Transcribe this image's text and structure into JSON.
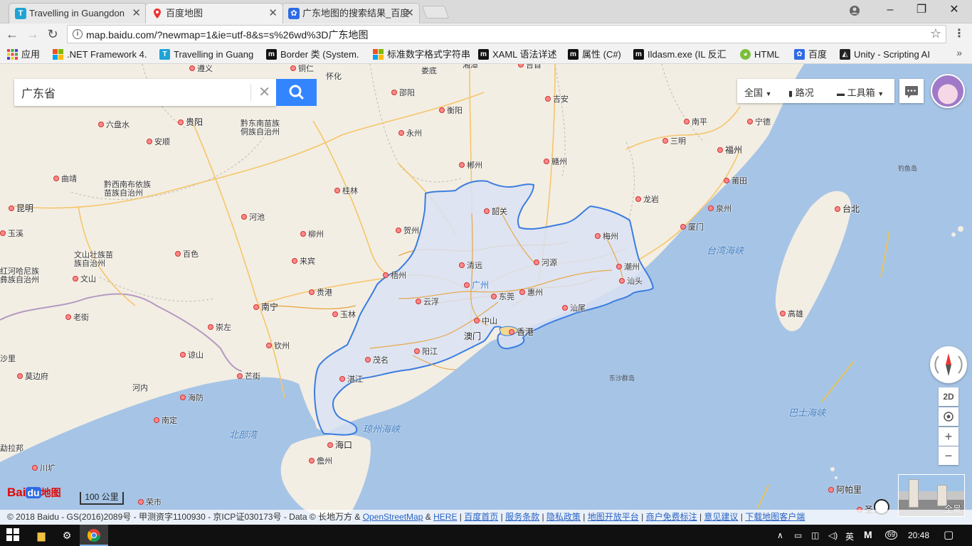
{
  "browser": {
    "tabs": [
      {
        "title": "Travelling in Guangdon",
        "active": false
      },
      {
        "title": "百度地图",
        "active": true
      },
      {
        "title": "广东地图的搜索结果_百度",
        "active": false
      }
    ],
    "close_glyph": "✕",
    "url": "map.baidu.com/?newmap=1&ie=utf-8&s=s%26wd%3D广东地图",
    "bookmarks": [
      {
        "label": "应用",
        "icon": "apps-grid-icon"
      },
      {
        "label": ".NET Framework 4.",
        "icon": "windows-logo-icon"
      },
      {
        "label": "Travelling in Guang",
        "icon": "t-logo-icon"
      },
      {
        "label": "Border 类 (System.",
        "icon": "m-logo-icon"
      },
      {
        "label": "标准数字格式字符串",
        "icon": "windows-logo-icon"
      },
      {
        "label": "XAML 语法详述",
        "icon": "m-logo-icon"
      },
      {
        "label": "属性 (C#)",
        "icon": "m-logo-icon"
      },
      {
        "label": "Ildasm.exe (IL 反汇",
        "icon": "m-logo-icon"
      },
      {
        "label": "HTML",
        "icon": "android-icon"
      },
      {
        "label": "百度",
        "icon": "baidu-paw-icon"
      },
      {
        "label": "Unity - Scripting AI",
        "icon": "unity-icon"
      }
    ]
  },
  "map": {
    "search": {
      "value": "广东省"
    },
    "tools": {
      "region": "全国",
      "traffic": "路况",
      "toolbox": "工具箱"
    },
    "controls": {
      "mode_2d": "2D",
      "zoom_in": "+",
      "zoom_out": "−"
    },
    "logo": {
      "bai": "Bai",
      "du": "du",
      "suffix": "地图"
    },
    "scale": "100 公里",
    "streetview": "全景",
    "cities": [
      {
        "name": "遵义"
      },
      {
        "name": "铜仁"
      },
      {
        "name": "怀化"
      },
      {
        "name": "娄底"
      },
      {
        "name": "湘潭"
      },
      {
        "name": "吉首"
      },
      {
        "name": "邵阳"
      },
      {
        "name": "吉安"
      },
      {
        "name": "衡阳"
      },
      {
        "name": "六盘水"
      },
      {
        "name": "贵阳"
      },
      {
        "name": "黔东南苗族侗族自治州"
      },
      {
        "name": "安顺"
      },
      {
        "name": "永州"
      },
      {
        "name": "南平"
      },
      {
        "name": "宁德"
      },
      {
        "name": "三明"
      },
      {
        "name": "福州"
      },
      {
        "name": "曲靖"
      },
      {
        "name": "黔西南布依族苗族自治州"
      },
      {
        "name": "郴州"
      },
      {
        "name": "赣州"
      },
      {
        "name": "莆田"
      },
      {
        "name": "桂林"
      },
      {
        "name": "昆明"
      },
      {
        "name": "韶关"
      },
      {
        "name": "龙岩"
      },
      {
        "name": "泉州"
      },
      {
        "name": "台北"
      },
      {
        "name": "玉溪"
      },
      {
        "name": "河池"
      },
      {
        "name": "贺州"
      },
      {
        "name": "厦门"
      },
      {
        "name": "柳州"
      },
      {
        "name": "梅州"
      },
      {
        "name": "文山壮族苗族自治州"
      },
      {
        "name": "百色"
      },
      {
        "name": "清远"
      },
      {
        "name": "河源"
      },
      {
        "name": "潮州"
      },
      {
        "name": "来宾"
      },
      {
        "name": "红河哈尼族彝族自治州"
      },
      {
        "name": "文山"
      },
      {
        "name": "梧州"
      },
      {
        "name": "汕头"
      },
      {
        "name": "广州"
      },
      {
        "name": "贵港"
      },
      {
        "name": "东莞"
      },
      {
        "name": "惠州"
      },
      {
        "name": "云浮"
      },
      {
        "name": "南宁"
      },
      {
        "name": "汕尾"
      },
      {
        "name": "高雄"
      },
      {
        "name": "老街"
      },
      {
        "name": "玉林"
      },
      {
        "name": "中山"
      },
      {
        "name": "崇左"
      },
      {
        "name": "澳门"
      },
      {
        "name": "香港"
      },
      {
        "name": "钦州"
      },
      {
        "name": "阳江"
      },
      {
        "name": "谅山"
      },
      {
        "name": "沙里"
      },
      {
        "name": "茂名"
      },
      {
        "name": "莫边府"
      },
      {
        "name": "芒街"
      },
      {
        "name": "湛江"
      },
      {
        "name": "河内"
      },
      {
        "name": "海防"
      },
      {
        "name": "南定"
      },
      {
        "name": "海口"
      },
      {
        "name": "勐拉邦"
      },
      {
        "name": "儋州"
      },
      {
        "name": "川圹"
      },
      {
        "name": "荣市"
      },
      {
        "name": "阿帕里"
      },
      {
        "name": "圣费"
      }
    ],
    "water_labels": [
      "台湾海峡",
      "北部湾",
      "琼州海峡",
      "巴士海峡"
    ],
    "minor_labels": [
      "钓鱼岛",
      "东沙群岛"
    ],
    "copyright": {
      "text": "© 2018 Baidu - GS(2016)2089号 - 甲测资字1100930 - 京ICP证030173号 - Data © 长地万方 &",
      "links": [
        "OpenStreetMap",
        "&",
        "HERE",
        "|",
        "百度首页",
        "|",
        "服务条款",
        "|",
        "隐私政策",
        "|",
        "地图开放平台",
        "|",
        "商户免费标注",
        "|",
        "意见建议",
        "|",
        "下载地图客户端"
      ]
    }
  },
  "taskbar": {
    "ime": "英",
    "badge": "69",
    "time": "20:48"
  },
  "colors": {
    "search_button": "#3385ff",
    "province_fill": "#d9e2f3",
    "province_border": "#3a7de0",
    "sea": "#a6c4e6",
    "land": "#f3eee3"
  }
}
